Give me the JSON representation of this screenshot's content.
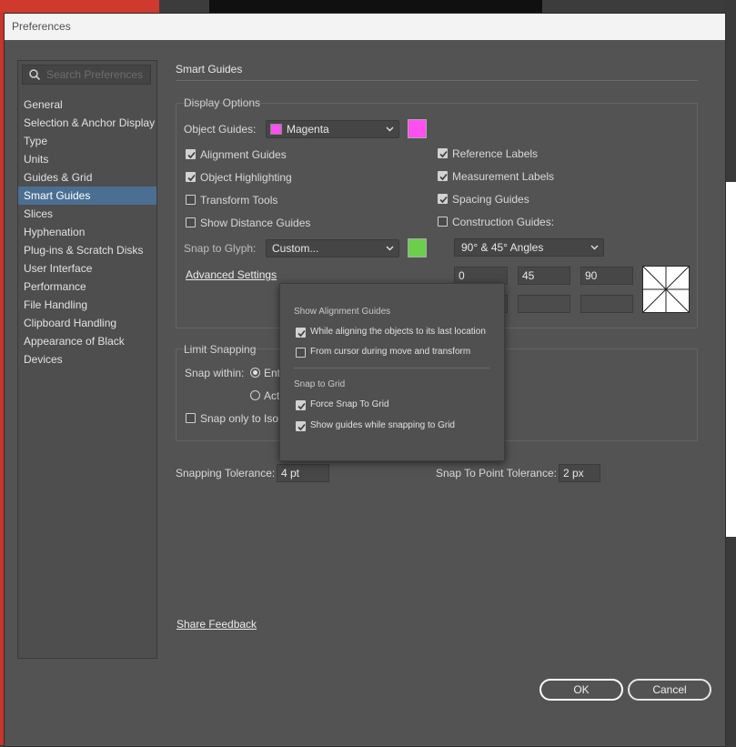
{
  "window": {
    "title": "Preferences"
  },
  "sidebar": {
    "search_placeholder": "Search Preferences",
    "items": [
      {
        "label": "General"
      },
      {
        "label": "Selection & Anchor Display"
      },
      {
        "label": "Type"
      },
      {
        "label": "Units"
      },
      {
        "label": "Guides & Grid"
      },
      {
        "label": "Smart Guides",
        "selected": true
      },
      {
        "label": "Slices"
      },
      {
        "label": "Hyphenation"
      },
      {
        "label": "Plug-ins & Scratch Disks"
      },
      {
        "label": "User Interface"
      },
      {
        "label": "Performance"
      },
      {
        "label": "File Handling"
      },
      {
        "label": "Clipboard Handling"
      },
      {
        "label": "Appearance of Black"
      },
      {
        "label": "Devices"
      }
    ]
  },
  "main": {
    "heading": "Smart Guides",
    "display_options": {
      "group_label": "Display Options",
      "object_guides_label": "Object Guides:",
      "object_guides_value": "Magenta",
      "object_guides_color": "#ff4ff0",
      "left_checks": [
        {
          "label": "Alignment Guides",
          "checked": true
        },
        {
          "label": "Object Highlighting",
          "checked": true
        },
        {
          "label": "Transform Tools",
          "checked": false
        },
        {
          "label": "Show Distance Guides",
          "checked": false
        }
      ],
      "right_checks": [
        {
          "label": "Reference Labels",
          "checked": true
        },
        {
          "label": "Measurement Labels",
          "checked": true
        },
        {
          "label": "Spacing Guides",
          "checked": true
        },
        {
          "label": "Construction Guides:",
          "checked": false
        }
      ],
      "snap_to_glyph_label": "Snap to Glyph:",
      "snap_to_glyph_value": "Custom...",
      "snap_to_glyph_color": "#6ccf4c",
      "construction_angles_value": "90° & 45° Angles",
      "advanced_settings_label": "Advanced Settings",
      "angles": [
        "0",
        "45",
        "90",
        "",
        "",
        ""
      ]
    },
    "limit_snapping": {
      "group_label": "Limit Snapping",
      "snap_within_label": "Snap within:",
      "radio_1_label": "Ent",
      "radio_2_label": "Act",
      "snap_only_label": "Snap only to Iso"
    },
    "snapping_tolerance_label": "Snapping Tolerance:",
    "snapping_tolerance_value": "4 pt",
    "snap_point_tolerance_label": "Snap To Point Tolerance:",
    "snap_point_tolerance_value": "2 px",
    "share_feedback_label": "Share Feedback"
  },
  "popup": {
    "section1_title": "Show Alignment Guides",
    "section1_items": [
      {
        "label": "While aligning the objects to its last location",
        "checked": true
      },
      {
        "label": "From cursor during move and transform",
        "checked": false
      }
    ],
    "section2_title": "Snap to Grid",
    "section2_items": [
      {
        "label": "Force Snap To Grid",
        "checked": true
      },
      {
        "label": "Show guides while snapping to Grid",
        "checked": true
      }
    ]
  },
  "buttons": {
    "ok": "OK",
    "cancel": "Cancel"
  }
}
